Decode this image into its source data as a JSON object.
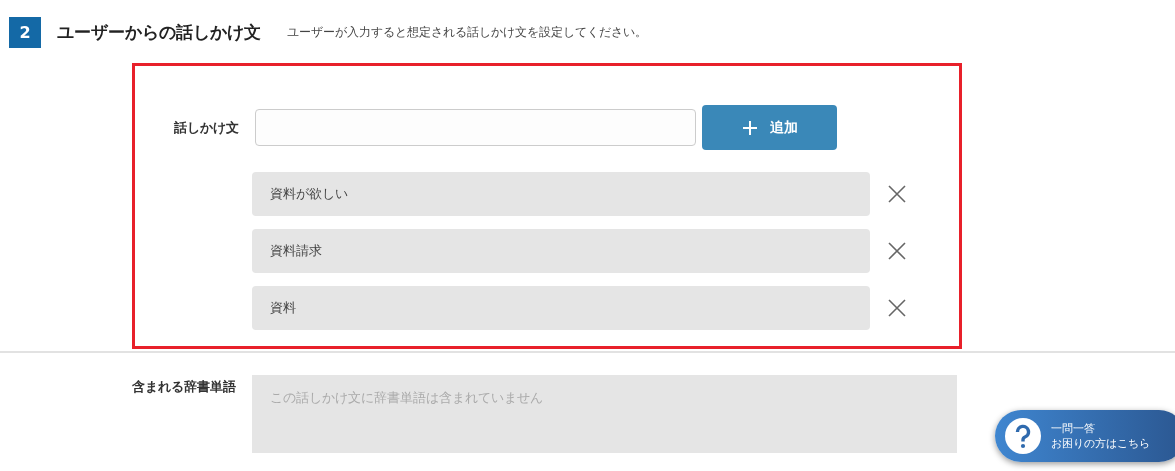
{
  "section": {
    "number": "2",
    "title": "ユーザーからの話しかけ文",
    "description": "ユーザーが入力すると想定される話しかけ文を設定してください。"
  },
  "input": {
    "label": "話しかけ文",
    "add_button": "追加"
  },
  "utterances": [
    {
      "text": "資料が欲しい"
    },
    {
      "text": "資料請求"
    },
    {
      "text": "資料"
    }
  ],
  "dictionary": {
    "label": "含まれる辞書単語",
    "placeholder": "この話しかけ文に辞書単語は含まれていません"
  },
  "help_button": {
    "line1": "一問一答",
    "line2": "お困りの方はこちら"
  }
}
